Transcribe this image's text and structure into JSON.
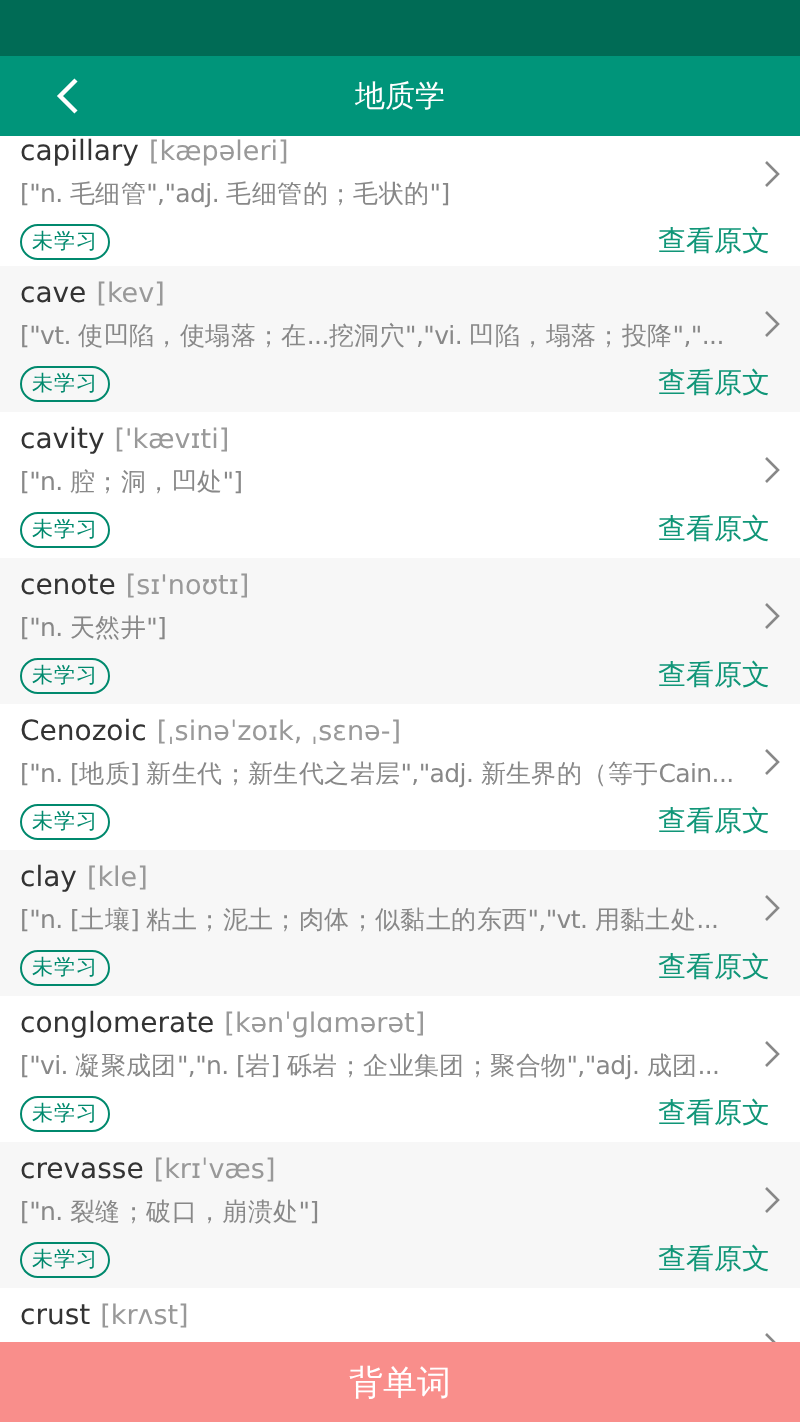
{
  "header": {
    "title": "地质学"
  },
  "words": [
    {
      "word": "capillary",
      "phonetic": "[kæpəleri]",
      "definition": "[\"n. 毛细管\",\"adj. 毛细管的；毛状的\"]",
      "status": "未学习",
      "link": "查看原文"
    },
    {
      "word": "cave",
      "phonetic": "[kev]",
      "definition": "[\"vt. 使凹陷，使塌落；在...挖洞穴\",\"vi. 凹陷，塌落；投降\",\"...",
      "status": "未学习",
      "link": "查看原文"
    },
    {
      "word": "cavity",
      "phonetic": "['kævɪti]",
      "definition": "[\"n. 腔；洞，凹处\"]",
      "status": "未学习",
      "link": "查看原文"
    },
    {
      "word": "cenote",
      "phonetic": "[sɪ'noʊtɪ]",
      "definition": "[\"n. 天然井\"]",
      "status": "未学习",
      "link": "查看原文"
    },
    {
      "word": "Cenozoic",
      "phonetic": "[ˌsinəˈzoɪk, ˌsɛnə-]",
      "definition": "[\"n. [地质] 新生代；新生代之岩层\",\"adj. 新生界的（等于Cain...",
      "status": "未学习",
      "link": "查看原文"
    },
    {
      "word": "clay",
      "phonetic": "[kle]",
      "definition": "[\"n. [土壤] 粘土；泥土；肉体；似黏土的东西\",\"vt. 用黏土处...",
      "status": "未学习",
      "link": "查看原文"
    },
    {
      "word": "conglomerate",
      "phonetic": "[kənˈɡlɑmərət]",
      "definition": "[\"vi. 凝聚成团\",\"n. [岩] 砾岩；企业集团；聚合物\",\"adj. 成团...",
      "status": "未学习",
      "link": "查看原文"
    },
    {
      "word": "crevasse",
      "phonetic": "[krɪˈvæs]",
      "definition": "[\"n. 裂缝；破口，崩溃处\"]",
      "status": "未学习",
      "link": "查看原文"
    },
    {
      "word": "crust",
      "phonetic": "[krʌst]"
    }
  ],
  "bottom_button": "背单词"
}
